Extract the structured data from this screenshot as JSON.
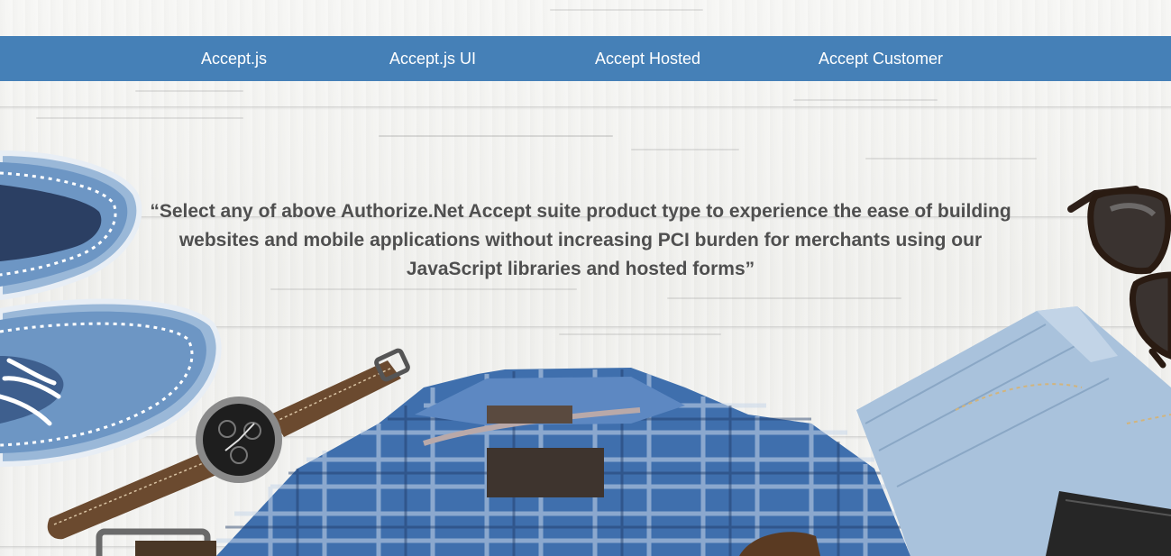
{
  "nav": {
    "items": [
      {
        "label": "Accept.js"
      },
      {
        "label": "Accept.js UI"
      },
      {
        "label": "Accept Hosted"
      },
      {
        "label": "Accept Customer"
      }
    ],
    "background_color": "#4580b7",
    "text_color": "#ffffff"
  },
  "hero": {
    "quote": "“Select any of above Authorize.Net Accept suite product type to experience the ease of building websites and mobile applications without increasing PCI burden for merchants using our JavaScript libraries and hosted forms”",
    "quote_color": "#4f4f4f",
    "background_image": "flat-lay-clothes-on-white-wood",
    "objects": [
      "blue-shoe",
      "wristwatch",
      "plaid-shirt",
      "denim-jeans",
      "sunglasses",
      "leather-wallet",
      "belt-buckle"
    ]
  }
}
